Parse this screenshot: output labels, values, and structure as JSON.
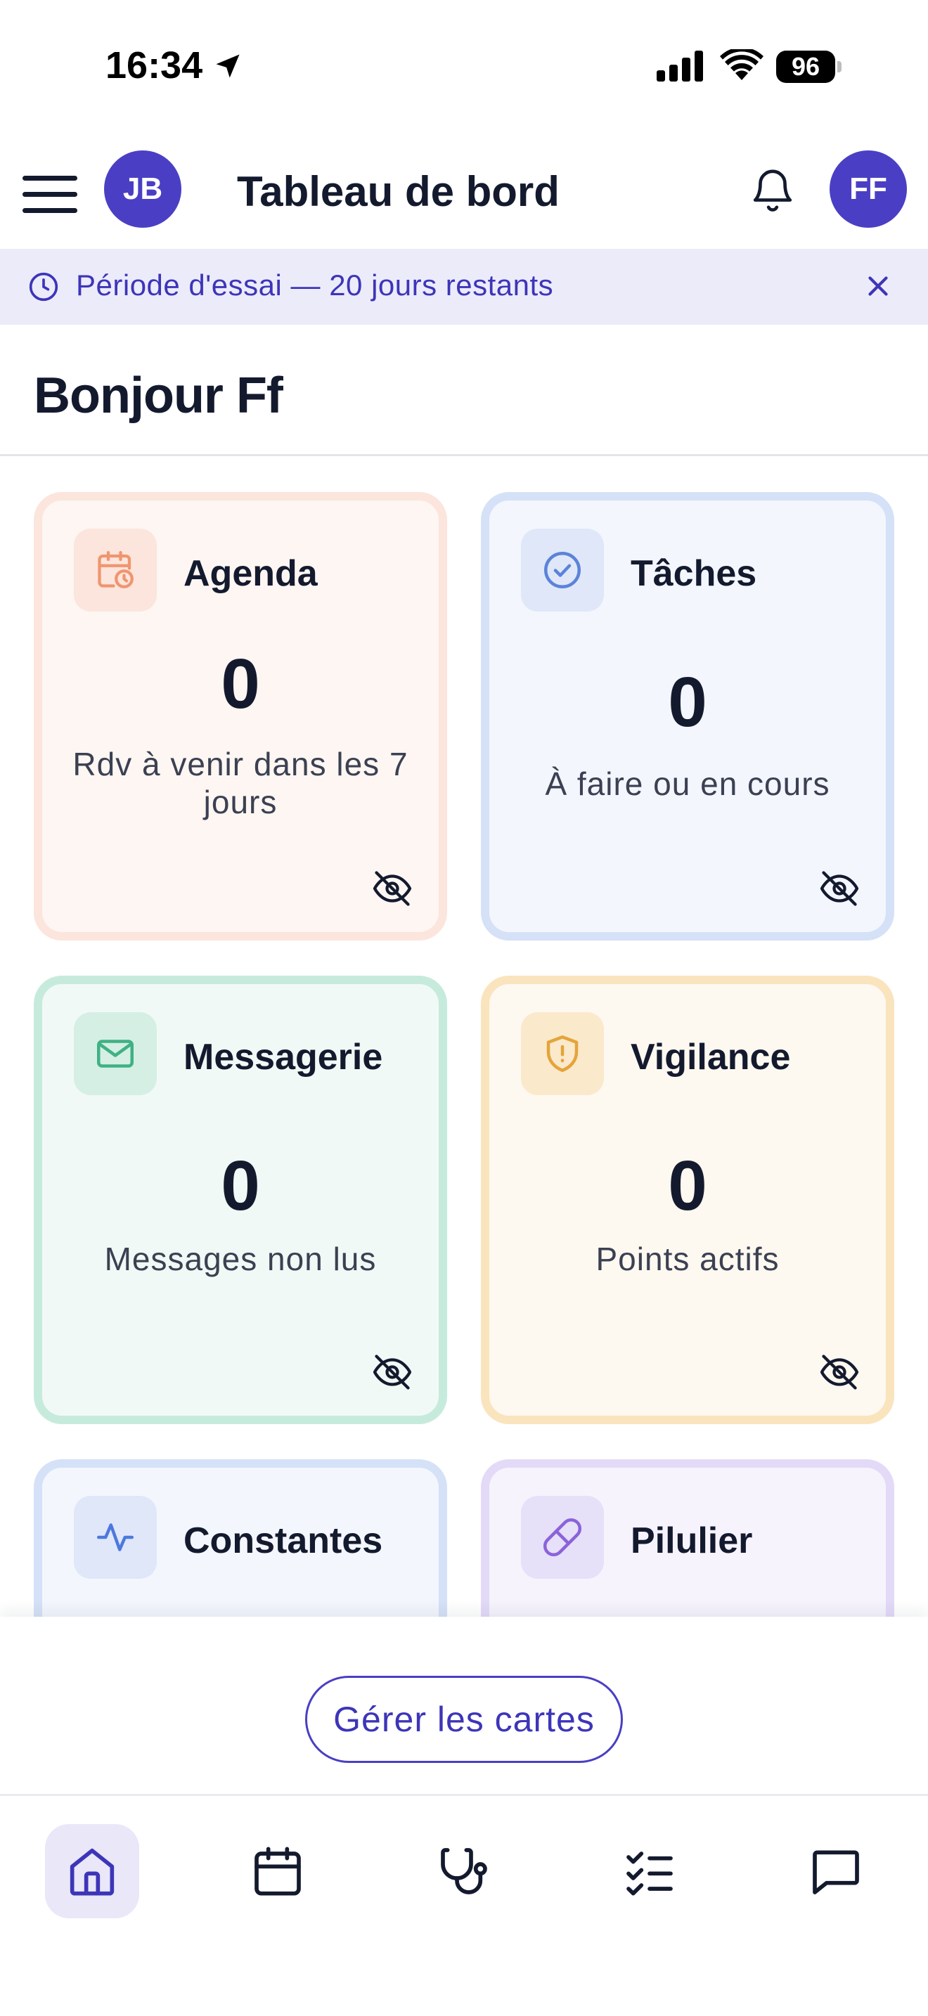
{
  "status_bar": {
    "time": "16:34",
    "battery": "96"
  },
  "header": {
    "avatar_left": "JB",
    "title": "Tableau de bord",
    "avatar_right": "FF"
  },
  "trial_banner": {
    "text": "Période d'essai — 20 jours restants"
  },
  "greeting": "Bonjour Ff",
  "cards": [
    {
      "title": "Agenda",
      "value": "0",
      "description": "Rdv à venir dans les 7 jours",
      "icon": "calendar-clock-icon"
    },
    {
      "title": "Tâches",
      "value": "0",
      "description": "À faire ou en cours",
      "icon": "check-circle-icon"
    },
    {
      "title": "Messagerie",
      "value": "0",
      "description": "Messages non lus",
      "icon": "mail-icon"
    },
    {
      "title": "Vigilance",
      "value": "0",
      "description": "Points actifs",
      "icon": "shield-alert-icon"
    },
    {
      "title": "Constantes",
      "icon": "activity-icon"
    },
    {
      "title": "Pilulier",
      "icon": "pill-icon"
    }
  ],
  "manage_button": "Gérer les cartes",
  "tab_bar": {
    "tabs": [
      "home-icon",
      "calendar-icon",
      "stethoscope-icon",
      "list-checks-icon",
      "message-icon"
    ],
    "active": "home-icon"
  },
  "colors": {
    "accent": "#4a3fc4",
    "banner_bg": "#ecebfa",
    "agenda": "#f0956f",
    "taches": "#5b83d9",
    "messagerie": "#3fb184",
    "vigilance": "#e5a43a",
    "constantes": "#4d79dd",
    "pilulier": "#8b63d9"
  }
}
